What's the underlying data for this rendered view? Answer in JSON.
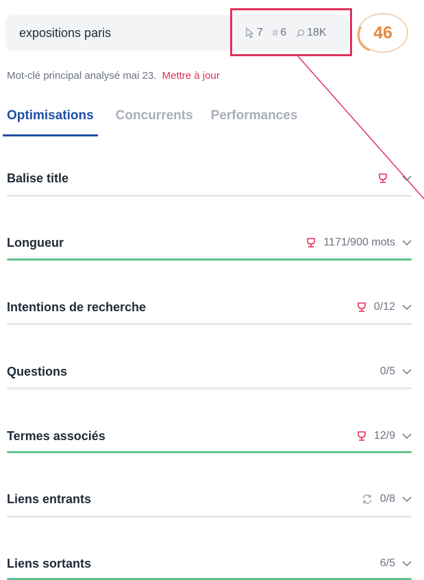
{
  "search": {
    "query": "expositions paris",
    "stats": {
      "clicks": "7",
      "rank": "6",
      "rank_prefix": "#",
      "volume": "18K"
    },
    "score": "46"
  },
  "keyword_info": {
    "text": "Mot-clé principal analysé mai 23.",
    "update_link": "Mettre à jour"
  },
  "tabs": [
    {
      "label": "Optimisations",
      "active": true
    },
    {
      "label": "Concurrents",
      "active": false
    },
    {
      "label": "Performances",
      "active": false
    }
  ],
  "sections": [
    {
      "title": "Balise title",
      "value": "",
      "icon": "trophy-icon",
      "complete": false
    },
    {
      "title": "Longueur",
      "value": "1171/900 mots",
      "icon": "trophy-icon",
      "complete": true
    },
    {
      "title": "Intentions de recherche",
      "value": "0/12",
      "icon": "trophy-icon",
      "complete": false
    },
    {
      "title": "Questions",
      "value": "0/5",
      "icon": "",
      "complete": false
    },
    {
      "title": "Termes associés",
      "value": "12/9",
      "icon": "trophy-icon",
      "complete": true
    },
    {
      "title": "Liens entrants",
      "value": "0/8",
      "icon": "refresh-icon",
      "complete": false
    },
    {
      "title": "Liens sortants",
      "value": "6/5",
      "icon": "",
      "complete": true
    }
  ],
  "colors": {
    "accent_blue": "#1e4fa6",
    "accent_red": "#e0305a",
    "score_orange": "#e9873f",
    "complete_green": "#5ec28c"
  }
}
